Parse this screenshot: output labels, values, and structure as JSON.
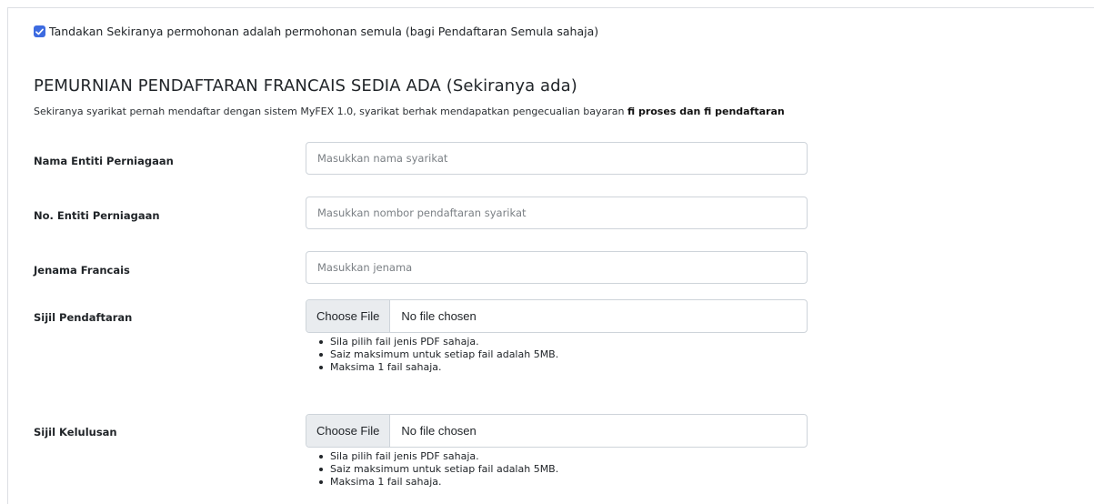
{
  "reapply": {
    "checked": true,
    "label": "Tandakan Sekiranya permohonan adalah permohonan semula (bagi Pendaftaran Semula sahaja)"
  },
  "section": {
    "title": "PEMURNIAN PENDAFTARAN FRANCAIS SEDIA ADA (Sekiranya ada)",
    "subtitle_prefix": "Sekiranya syarikat pernah mendaftar dengan sistem MyFEX 1.0, syarikat berhak mendapatkan pengecualian bayaran ",
    "subtitle_bold": "fi proses dan fi pendaftaran"
  },
  "fields": {
    "company_name": {
      "label": "Nama Entiti Perniagaan",
      "placeholder": "Masukkan nama syarikat",
      "value": ""
    },
    "company_no": {
      "label": "No. Entiti Perniagaan",
      "placeholder": "Masukkan nombor pendaftaran syarikat",
      "value": ""
    },
    "brand": {
      "label": "Jenama Francais",
      "placeholder": "Masukkan jenama",
      "value": ""
    }
  },
  "uploads": {
    "registration_cert": {
      "label": "Sijil Pendaftaran",
      "button": "Choose File",
      "status": "No file chosen",
      "hints": [
        "Sila pilih fail jenis PDF sahaja.",
        "Saiz maksimum untuk setiap fail adalah 5MB.",
        "Maksima 1 fail sahaja."
      ]
    },
    "approval_cert": {
      "label": "Sijil Kelulusan",
      "button": "Choose File",
      "status": "No file chosen",
      "hints": [
        "Sila pilih fail jenis PDF sahaja.",
        "Saiz maksimum untuk setiap fail adalah 5MB.",
        "Maksima 1 fail sahaja."
      ]
    }
  },
  "colors": {
    "accent": "#3d6be0",
    "border": "#ced4da",
    "file_button_bg": "#e9ecef"
  }
}
